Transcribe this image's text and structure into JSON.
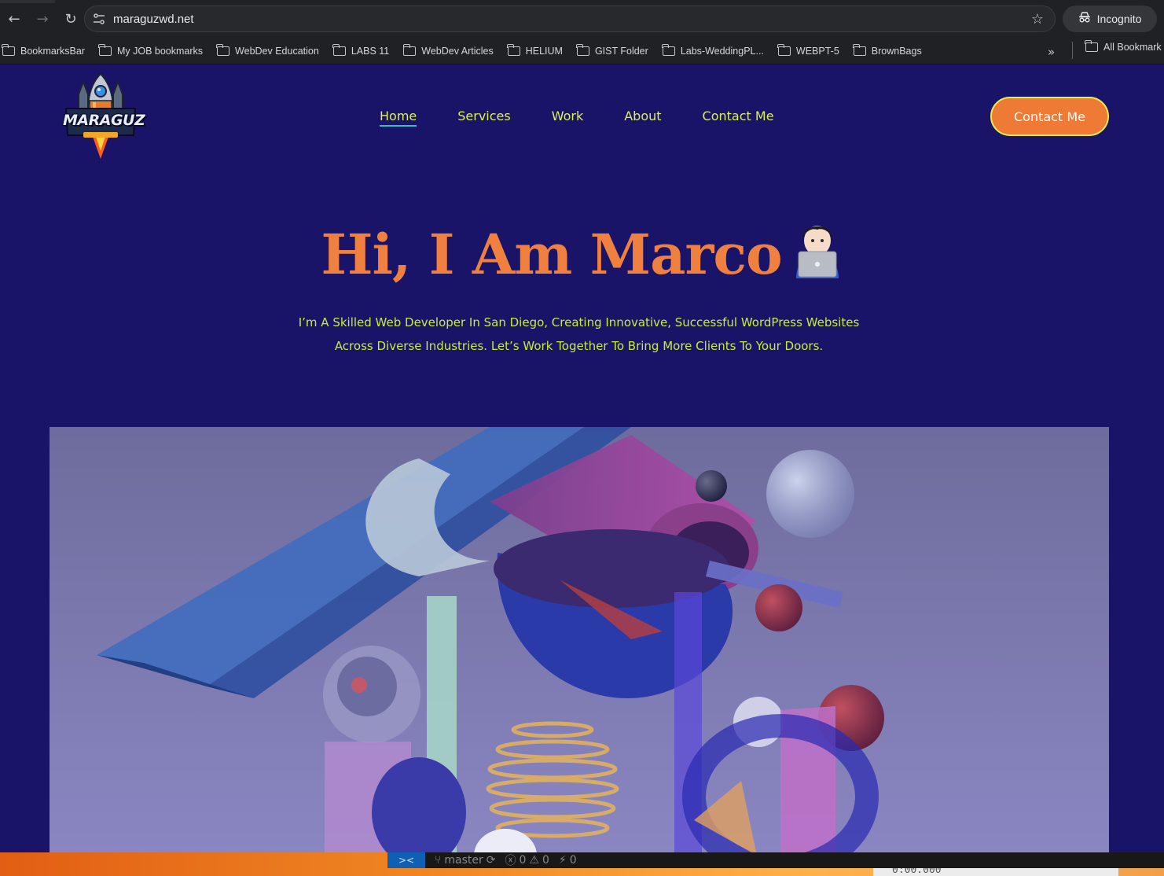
{
  "browser": {
    "url": "maraguzwd.net",
    "profile_label": "Incognito",
    "bookmarks": [
      "BookmarksBar",
      "My JOB bookmarks",
      "WebDev Education",
      "LABS 11",
      "WebDev Articles",
      "HELIUM",
      "GIST Folder",
      "Labs-WeddingPL...",
      "WEBPT-5",
      "BrownBags"
    ],
    "all_bookmarks_label": "All Bookmark",
    "more_glyph": "»"
  },
  "site": {
    "logo_text": "MARAGUZ",
    "nav": [
      "Home",
      "Services",
      "Work",
      "About",
      "Contact Me"
    ],
    "active_nav": "Home",
    "cta_label": "Contact Me",
    "hero": {
      "title": "Hi, I Am Marco",
      "subtitle_line1": "I’m A Skilled Web Developer In San Diego, Creating Innovative, Successful WordPress Websites",
      "subtitle_line2": "Across Diverse Industries. Let’s Work Together To Bring More Clients To Your Doors."
    },
    "colors": {
      "background": "#1a1468",
      "accent_orange": "#f08040",
      "nav_text": "#d9f05b",
      "subtitle_text": "#c9ec38",
      "cta_border": "#e6ef4a",
      "active_underline": "#2ec4c4"
    }
  },
  "editor_status": {
    "branch": "master",
    "errors": "0",
    "warnings": "0",
    "ports": "0",
    "timer": "0:00.000"
  }
}
